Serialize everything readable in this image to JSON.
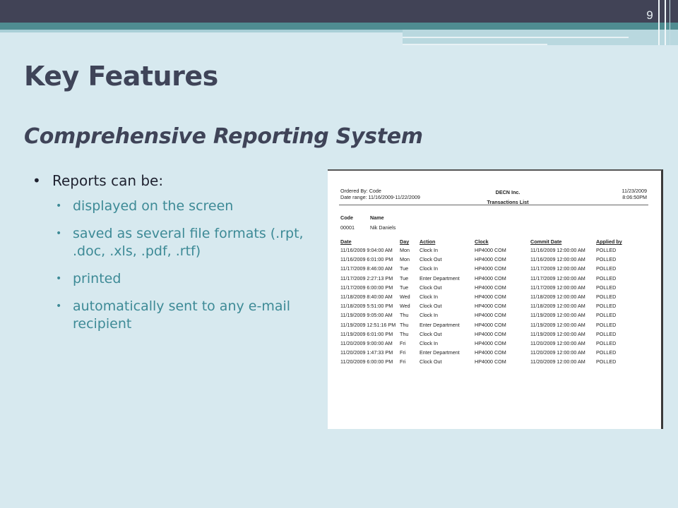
{
  "slide": {
    "number": "9",
    "title": "Key Features",
    "subtitle": "Comprehensive Reporting System",
    "bullet_main": "Reports can be:",
    "sub_bullets": [
      "displayed on the screen",
      "saved as several file formats (.rpt, .doc, .xls, .pdf, .rtf)",
      "printed",
      "automatically sent to any e-mail recipient"
    ],
    "colors": {
      "header_dark": "#414356",
      "accent_teal": "#4f8c91",
      "background": "#d7e9ef",
      "sub_bullet_text": "#3d8a96"
    }
  },
  "report": {
    "ordered_by": "Ordered By:  Code",
    "date_range": "Date range:   11/16/2009-11/22/2009",
    "company": "DECN Inc.",
    "report_title": "Transactions List",
    "print_date": "11/23/2009",
    "print_time": "8:06:50PM",
    "employee_headers": [
      "Code",
      "Name"
    ],
    "employee": [
      "00001",
      "Nik Daniels"
    ],
    "columns": [
      "Date",
      "Day",
      "Action",
      "Clock",
      "Commit Date",
      "Applied by"
    ],
    "rows": [
      [
        "11/16/2009 9:04:00 AM",
        "Mon",
        "Clock In",
        "HP4000 COM",
        "11/16/2009 12:00:00 AM",
        "POLLED"
      ],
      [
        "11/16/2009 6:01:00 PM",
        "Mon",
        "Clock Out",
        "HP4000 COM",
        "11/16/2009 12:00:00 AM",
        "POLLED"
      ],
      [
        "11/17/2009 8:46:00 AM",
        "Tue",
        "Clock In",
        "HP4000 COM",
        "11/17/2009 12:00:00 AM",
        "POLLED"
      ],
      [
        "11/17/2009 2:27:13 PM",
        "Tue",
        "Enter Department",
        "HP4000 COM",
        "11/17/2009 12:00:00 AM",
        "POLLED"
      ],
      [
        "11/17/2009 6:00:00 PM",
        "Tue",
        "Clock Out",
        "HP4000 COM",
        "11/17/2009 12:00:00 AM",
        "POLLED"
      ],
      [
        "11/18/2009 8:40:00 AM",
        "Wed",
        "Clock In",
        "HP4000 COM",
        "11/18/2009 12:00:00 AM",
        "POLLED"
      ],
      [
        "11/18/2009 5:51:00 PM",
        "Wed",
        "Clock Out",
        "HP4000 COM",
        "11/18/2009 12:00:00 AM",
        "POLLED"
      ],
      [
        "11/19/2009 9:05:00 AM",
        "Thu",
        "Clock In",
        "HP4000 COM",
        "11/19/2009 12:00:00 AM",
        "POLLED"
      ],
      [
        "11/19/2009 12:51:16 PM",
        "Thu",
        "Enter Department",
        "HP4000 COM",
        "11/19/2009 12:00:00 AM",
        "POLLED"
      ],
      [
        "11/19/2009 6:01:00 PM",
        "Thu",
        "Clock Out",
        "HP4000 COM",
        "11/19/2009 12:00:00 AM",
        "POLLED"
      ],
      [
        "11/20/2009 9:00:00 AM",
        "Fri",
        "Clock In",
        "HP4000 COM",
        "11/20/2009 12:00:00 AM",
        "POLLED"
      ],
      [
        "11/20/2009 1:47:33 PM",
        "Fri",
        "Enter Department",
        "HP4000 COM",
        "11/20/2009 12:00:00 AM",
        "POLLED"
      ],
      [
        "11/20/2009 6:00:00 PM",
        "Fri",
        "Clock Out",
        "HP4000 COM",
        "11/20/2009 12:00:00 AM",
        "POLLED"
      ]
    ]
  }
}
